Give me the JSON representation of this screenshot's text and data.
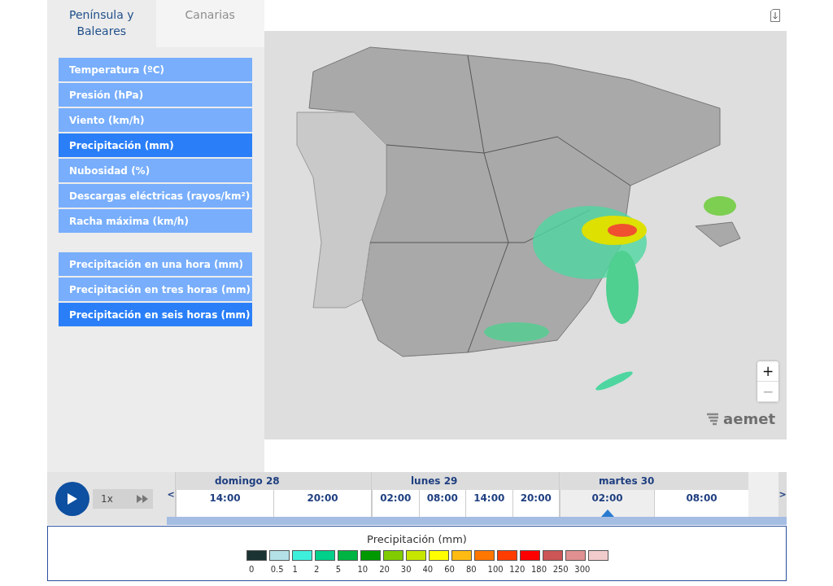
{
  "tabs": [
    {
      "label": "Península y Baleares",
      "selected": true
    },
    {
      "label": "Canarias",
      "selected": false
    }
  ],
  "variables": [
    {
      "label": "Temperatura (ºC)",
      "selected": false
    },
    {
      "label": "Presión (hPa)",
      "selected": false
    },
    {
      "label": "Viento (km/h)",
      "selected": false
    },
    {
      "label": "Precipitación (mm)",
      "selected": true
    },
    {
      "label": "Nubosidad (%)",
      "selected": false
    },
    {
      "label": "Descargas eléctricas (rayos/km²)",
      "selected": false
    },
    {
      "label": "Racha máxima (km/h)",
      "selected": false
    }
  ],
  "periods": [
    {
      "label": "Precipitación en una hora (mm)",
      "selected": false
    },
    {
      "label": "Precipitación en tres horas (mm)",
      "selected": false
    },
    {
      "label": "Precipitación en seis horas (mm)",
      "selected": true
    }
  ],
  "map": {
    "zoom_in": "+",
    "zoom_out": "−",
    "logo": "aemet"
  },
  "player": {
    "speed": "1x"
  },
  "timeline": {
    "prev": "<",
    "next": ">",
    "days": [
      {
        "label": "domingo 28",
        "hours": [
          {
            "label": "14:00",
            "selected": false
          },
          {
            "label": "20:00",
            "selected": false
          }
        ]
      },
      {
        "label": "lunes 29",
        "hours": [
          {
            "label": "02:00",
            "selected": false
          },
          {
            "label": "08:00",
            "selected": false
          },
          {
            "label": "14:00",
            "selected": false
          },
          {
            "label": "20:00",
            "selected": false
          }
        ]
      },
      {
        "label": "martes 30",
        "hours": [
          {
            "label": "02:00",
            "selected": true
          },
          {
            "label": "08:00",
            "selected": false
          }
        ]
      }
    ]
  },
  "legend": {
    "title": "Precipitación (mm)",
    "items": [
      {
        "label": "0",
        "color": "#1b3333"
      },
      {
        "label": "0.5",
        "color": "#b4e1e8"
      },
      {
        "label": "1",
        "color": "#3ef0dc"
      },
      {
        "label": "2",
        "color": "#00d08a"
      },
      {
        "label": "5",
        "color": "#00b444"
      },
      {
        "label": "10",
        "color": "#009a00"
      },
      {
        "label": "20",
        "color": "#80cc00"
      },
      {
        "label": "30",
        "color": "#c6e600"
      },
      {
        "label": "40",
        "color": "#ffff00"
      },
      {
        "label": "60",
        "color": "#ffbb11"
      },
      {
        "label": "80",
        "color": "#ff7700"
      },
      {
        "label": "100",
        "color": "#ff3d00"
      },
      {
        "label": "120",
        "color": "#ff0000"
      },
      {
        "label": "180",
        "color": "#cc5555"
      },
      {
        "label": "250",
        "color": "#e09090"
      },
      {
        "label": "300",
        "color": "#f2cccc"
      }
    ]
  }
}
